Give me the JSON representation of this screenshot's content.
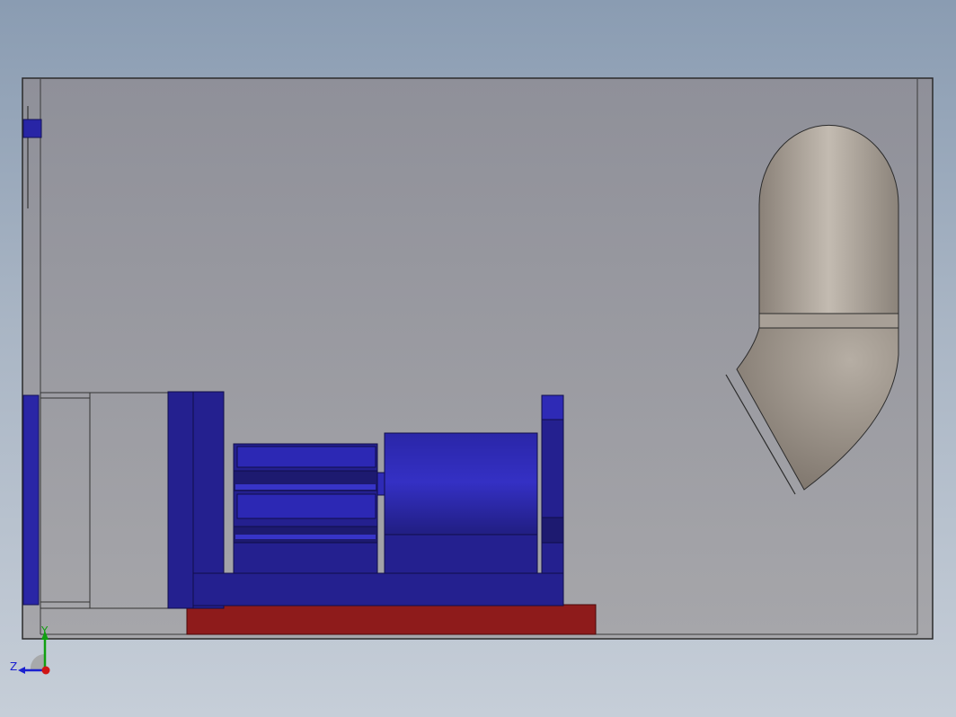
{
  "viewport": {
    "background_top": "#8a9cb2",
    "background_bottom": "#c6ced8"
  },
  "model": {
    "enclosure_color": "#9fa0a6",
    "enclosure_edge": "#2b2b2b",
    "motor_color": "#24208f",
    "motor_shade": "#15125e",
    "motor_highlight": "#3a36c0",
    "base_color": "#8e1b1b",
    "duct_color": "#a79e95",
    "duct_highlight": "#c8c0b6",
    "duct_shadow": "#7d756d"
  },
  "triad": {
    "y_label": "Y",
    "z_label": "Z",
    "x_color": "#d01515",
    "y_color": "#10a010",
    "z_color": "#1a20d0"
  }
}
